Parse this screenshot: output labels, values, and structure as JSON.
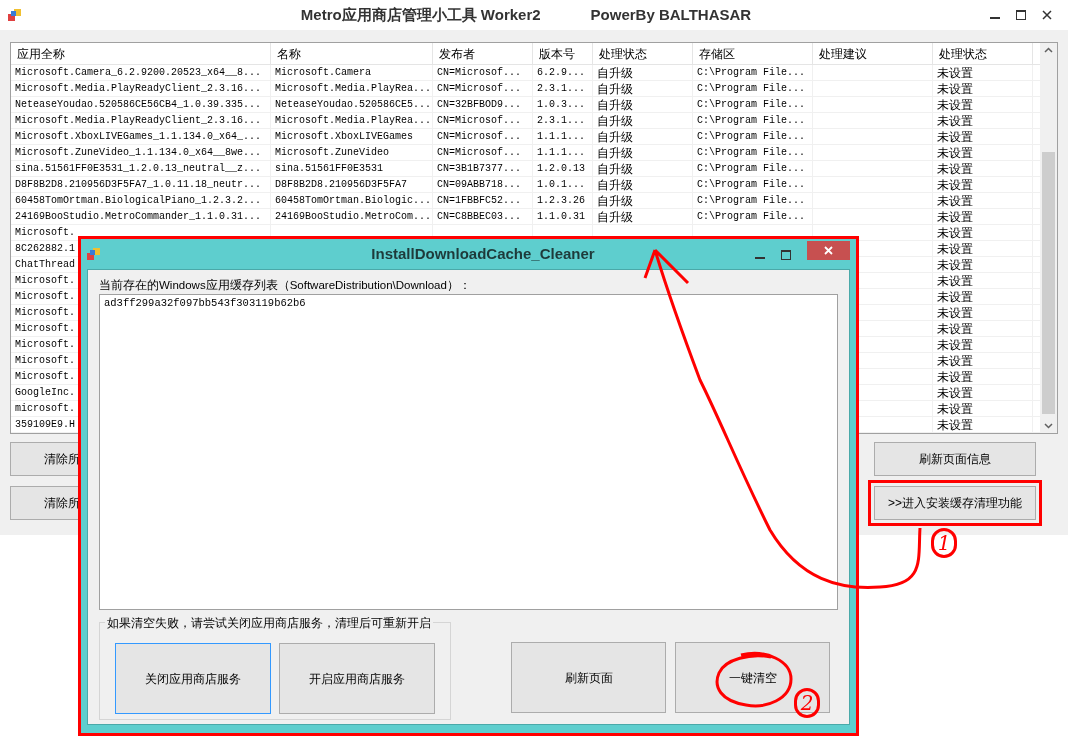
{
  "window": {
    "title": "Metro应用商店管理小工具 Worker2",
    "subtitle": "PowerBy BALTHASAR"
  },
  "table": {
    "columns": [
      "应用全称",
      "名称",
      "发布者",
      "版本号",
      "处理状态",
      "存储区",
      "处理建议",
      "处理状态"
    ],
    "rows": [
      {
        "cells": [
          "Microsoft.Camera_6.2.9200.20523_x64__8...",
          "Microsoft.Camera",
          "CN=Microsof...",
          "6.2.9...",
          "自升级",
          "C:\\Program File...",
          null,
          "未设置"
        ]
      },
      {
        "cells": [
          "Microsoft.Media.PlayReadyClient_2.3.16...",
          "Microsoft.Media.PlayRea...",
          "CN=Microsof...",
          "2.3.1...",
          "自升级",
          "C:\\Program File...",
          null,
          "未设置"
        ]
      },
      {
        "cells": [
          "NeteaseYoudao.520586CE56CB4_1.0.39.335...",
          "NeteaseYoudao.520586CE5...",
          "CN=32BFBOD9...",
          "1.0.3...",
          "自升级",
          "C:\\Program File...",
          null,
          "未设置"
        ]
      },
      {
        "cells": [
          "Microsoft.Media.PlayReadyClient_2.3.16...",
          "Microsoft.Media.PlayRea...",
          "CN=Microsof...",
          "2.3.1...",
          "自升级",
          "C:\\Program File...",
          null,
          "未设置"
        ]
      },
      {
        "cells": [
          "Microsoft.XboxLIVEGames_1.1.134.0_x64_...",
          "Microsoft.XboxLIVEGames",
          "CN=Microsof...",
          "1.1.1...",
          "自升级",
          "C:\\Program File...",
          null,
          "未设置"
        ]
      },
      {
        "cells": [
          "Microsoft.ZuneVideo_1.1.134.0_x64__8we...",
          "Microsoft.ZuneVideo",
          "CN=Microsof...",
          "1.1.1...",
          "自升级",
          "C:\\Program File...",
          null,
          "未设置"
        ]
      },
      {
        "cells": [
          "sina.51561FF0E3531_1.2.0.13_neutral__z...",
          "sina.51561FF0E3531",
          "CN=3B1B7377...",
          "1.2.0.13",
          "自升级",
          "C:\\Program File...",
          null,
          "未设置"
        ]
      },
      {
        "cells": [
          "D8F8B2D8.210956D3F5FA7_1.0.11.18_neutr...",
          "D8F8B2D8.210956D3F5FA7",
          "CN=09ABB718...",
          "1.0.1...",
          "自升级",
          "C:\\Program File...",
          null,
          "未设置"
        ]
      },
      {
        "cells": [
          "60458TomOrtman.BiologicalPiano_1.2.3.2...",
          "60458TomOrtman.Biologic...",
          "CN=1FBBFC52...",
          "1.2.3.26",
          "自升级",
          "C:\\Program File...",
          null,
          "未设置"
        ]
      },
      {
        "cells": [
          "24169BooStudio.MetroCommander_1.1.0.31...",
          "24169BooStudio.MetroCom...",
          "CN=C8BBEC03...",
          "1.1.0.31",
          "自升级",
          "C:\\Program File...",
          null,
          "未设置"
        ]
      },
      {
        "cells": [
          "Microsoft.",
          "未设置"
        ]
      },
      {
        "cells": [
          "8C262882.1",
          "未设置"
        ]
      },
      {
        "cells": [
          "ChatThread",
          "未设置"
        ]
      },
      {
        "cells": [
          "Microsoft.",
          "未设置"
        ]
      },
      {
        "cells": [
          "Microsoft.",
          "未设置"
        ]
      },
      {
        "cells": [
          "Microsoft.",
          "未设置"
        ]
      },
      {
        "cells": [
          "Microsoft.",
          "未设置"
        ]
      },
      {
        "cells": [
          "Microsoft.",
          "未设置"
        ]
      },
      {
        "cells": [
          "Microsoft.",
          "未设置"
        ]
      },
      {
        "cells": [
          "Microsoft.",
          "未设置"
        ]
      },
      {
        "cells": [
          "GoogleInc.",
          "未设置"
        ]
      },
      {
        "cells": [
          "microsoft.",
          "未设置"
        ]
      },
      {
        "cells": [
          "359109E9.H",
          "未设置"
        ]
      }
    ]
  },
  "buttons_left": [
    "清除所",
    "清除所"
  ],
  "buttons_right": [
    {
      "label": "刷新页面信息",
      "highlighted": false
    },
    {
      "label": ">>进入安装缓存清理功能",
      "highlighted": true
    }
  ],
  "dialog": {
    "title": "InstallDownloadCache_Cleaner",
    "list_label": "当前存在的Windows应用缓存列表（SoftwareDistribution\\Download）：",
    "list_items": [
      "ad3ff299a32f097bb543f303119b62b6"
    ],
    "group_label": "如果清空失败，请尝试关闭应用商店服务，清理后可重新开启",
    "group_buttons": [
      {
        "label": "关闭应用商店服务",
        "focused": true
      },
      {
        "label": "开启应用商店服务",
        "focused": false
      }
    ],
    "action_buttons": [
      {
        "label": "刷新页面",
        "circled": false
      },
      {
        "label": "一键清空",
        "circled": true
      }
    ]
  },
  "annotations": [
    "1",
    "2"
  ]
}
